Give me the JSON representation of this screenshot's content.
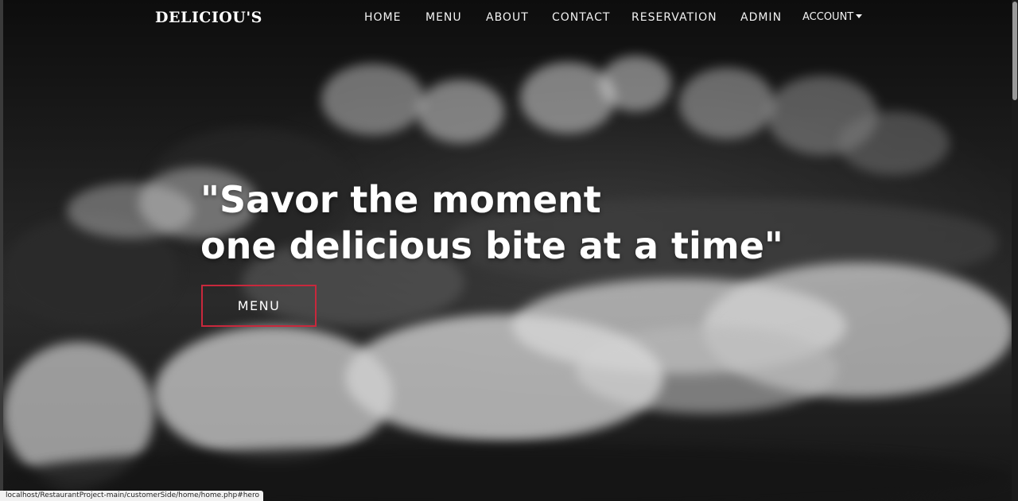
{
  "navbar": {
    "brand": "DELICIOU'S",
    "links": [
      {
        "label": "HOME"
      },
      {
        "label": "MENU"
      },
      {
        "label": "ABOUT"
      },
      {
        "label": "CONTACT"
      },
      {
        "label": "RESERVATION"
      },
      {
        "label": "ADMIN"
      }
    ],
    "account": {
      "label": "ACCOUNT",
      "icon": "caret-down-icon"
    }
  },
  "hero": {
    "headline_line1": "\"Savor the moment",
    "headline_line2": "one delicious bite at a time\"",
    "button_label": "MENU",
    "button_border_color": "#c8283c",
    "background_image": "grayscale-grilled-food-photo"
  },
  "status_bar": {
    "url": "localhost/RestaurantProject-main/customerSide/home/home.php#hero"
  }
}
